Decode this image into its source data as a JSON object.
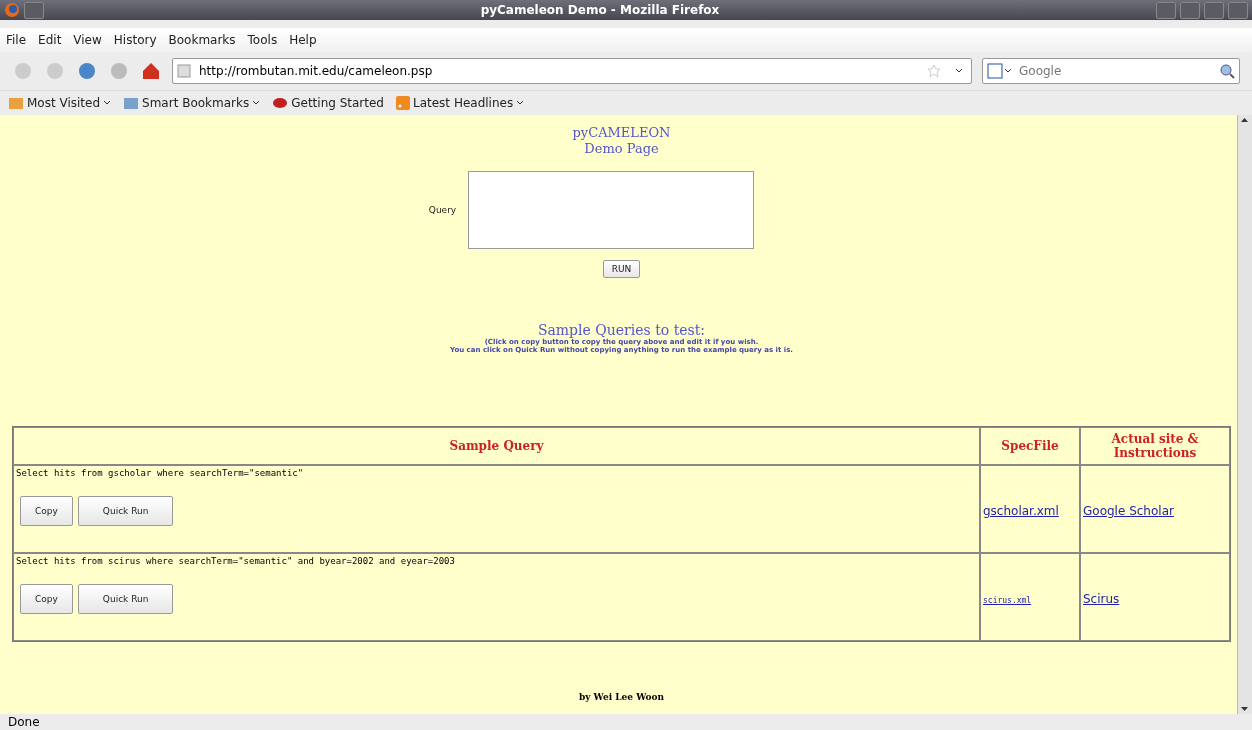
{
  "window": {
    "title": "pyCameleon Demo - Mozilla Firefox"
  },
  "menu": [
    "File",
    "Edit",
    "View",
    "History",
    "Bookmarks",
    "Tools",
    "Help"
  ],
  "address": {
    "value": "http://rombutan.mit.edu/cameleon.psp"
  },
  "search": {
    "placeholder": "Google"
  },
  "bookmarks": [
    {
      "label": "Most Visited",
      "dropdown": true,
      "kind": "folder"
    },
    {
      "label": "Smart Bookmarks",
      "dropdown": true,
      "kind": "smart"
    },
    {
      "label": "Getting Started",
      "dropdown": false,
      "kind": "page"
    },
    {
      "label": "Latest Headlines",
      "dropdown": true,
      "kind": "feed"
    }
  ],
  "page": {
    "title": "pyCAMELEON",
    "subtitle": "Demo Page",
    "query_label": "Query",
    "run_button": "RUN",
    "samples_heading": "Sample Queries to test:",
    "notes": [
      "(Click on copy button to copy the query above and edit it if you wish.",
      "You can click on Quick Run without copying anything to run the example query as it is."
    ],
    "table": {
      "columns": [
        "Sample Query",
        "SpecFile",
        "Actual site & Instructions"
      ],
      "rows": [
        {
          "query": "Select hits from gscholar where searchTerm=\"semantic\"",
          "buttons": [
            "Copy",
            "Quick Run"
          ],
          "specfile": {
            "label": "gscholar.xml",
            "kind": "plain"
          },
          "site": "Google Scholar"
        },
        {
          "query": "Select hits from scirus where searchTerm=\"semantic\" and byear=2002 and eyear=2003",
          "buttons": [
            "Copy",
            "Quick Run"
          ],
          "specfile": {
            "label": "scirus.xml",
            "kind": "mono"
          },
          "site": "Scirus"
        }
      ]
    },
    "footer": "by Wei Lee Woon"
  },
  "status_bar": "Done"
}
